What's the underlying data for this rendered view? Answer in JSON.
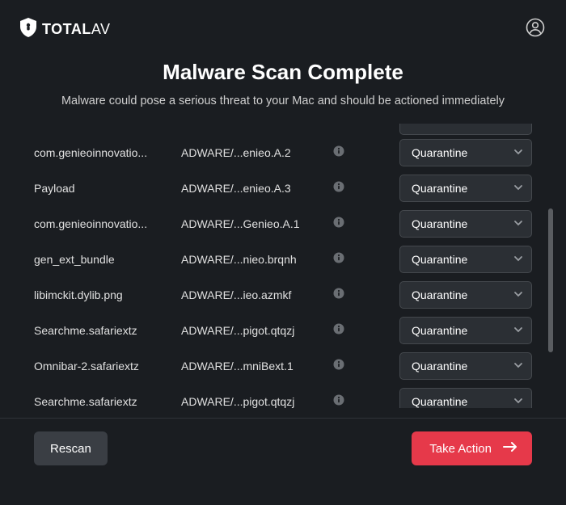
{
  "brand": {
    "bold": "TOTAL",
    "thin": "AV"
  },
  "title": "Malware Scan Complete",
  "subtitle": "Malware could pose a serious threat to your Mac and should be actioned immediately",
  "action_label": "Quarantine",
  "rows": [
    {
      "name": "com.genieoinnovatio...",
      "threat": "ADWARE/...enieo.A.2"
    },
    {
      "name": "Payload",
      "threat": "ADWARE/...enieo.A.3"
    },
    {
      "name": "com.genieoinnovatio...",
      "threat": "ADWARE/...Genieo.A.1"
    },
    {
      "name": "gen_ext_bundle",
      "threat": "ADWARE/...nieo.brqnh"
    },
    {
      "name": "libimckit.dylib.png",
      "threat": "ADWARE/...ieo.azmkf"
    },
    {
      "name": "Searchme.safariextz",
      "threat": "ADWARE/...pigot.qtqzj"
    },
    {
      "name": "Omnibar-2.safariextz",
      "threat": "ADWARE/...mniBext.1"
    },
    {
      "name": "Searchme.safariextz",
      "threat": "ADWARE/...pigot.qtqzj"
    }
  ],
  "footer": {
    "rescan": "Rescan",
    "take_action": "Take Action"
  }
}
